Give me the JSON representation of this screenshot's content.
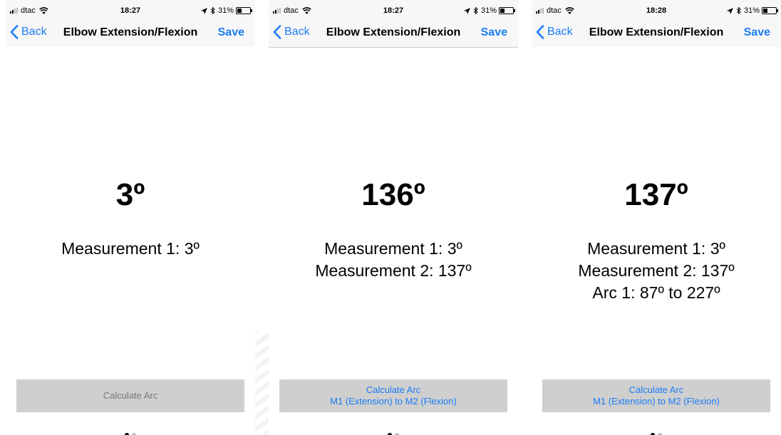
{
  "status_bar": {
    "carrier": "dtac",
    "battery": "31%",
    "battery_level": 0.31
  },
  "screens": [
    {
      "time": "18:27",
      "back_label": "Back",
      "title": "Elbow Extension/Flexion",
      "save_label": "Save",
      "current_angle": "3º",
      "measurements": [
        "Measurement 1: 3º"
      ],
      "button_lines": [
        "Calculate Arc"
      ],
      "button_state": "disabled",
      "page_index": 1,
      "page_count": 2
    },
    {
      "time": "18:27",
      "back_label": "Back",
      "title": "Elbow Extension/Flexion",
      "save_label": "Save",
      "current_angle": "136º",
      "measurements": [
        "Measurement 1: 3º",
        "Measurement 2: 137º"
      ],
      "button_lines": [
        "Calculate Arc",
        "M1 (Extension) to M2 (Flexion)"
      ],
      "button_state": "enabled",
      "page_index": 1,
      "page_count": 2
    },
    {
      "time": "18:28",
      "back_label": "Back",
      "title": "Elbow Extension/Flexion",
      "save_label": "Save",
      "current_angle": "137º",
      "measurements": [
        "Measurement 1: 3º",
        "Measurement 2: 137º",
        "Arc 1: 87º to 227º"
      ],
      "button_lines": [
        "Calculate Arc",
        "M1 (Extension) to M2 (Flexion)"
      ],
      "button_state": "enabled",
      "page_index": 1,
      "page_count": 2
    }
  ],
  "icons": {
    "back": "chevron-left-icon",
    "signal": "cellular-signal-icon",
    "wifi": "wifi-icon",
    "location": "location-arrow-icon",
    "bluetooth": "bluetooth-icon",
    "battery": "battery-icon"
  },
  "colors": {
    "accent": "#1a7cf5",
    "bar_background": "#f7f7f7",
    "button_background": "#cfcfcf",
    "button_disabled_text": "#777777"
  }
}
